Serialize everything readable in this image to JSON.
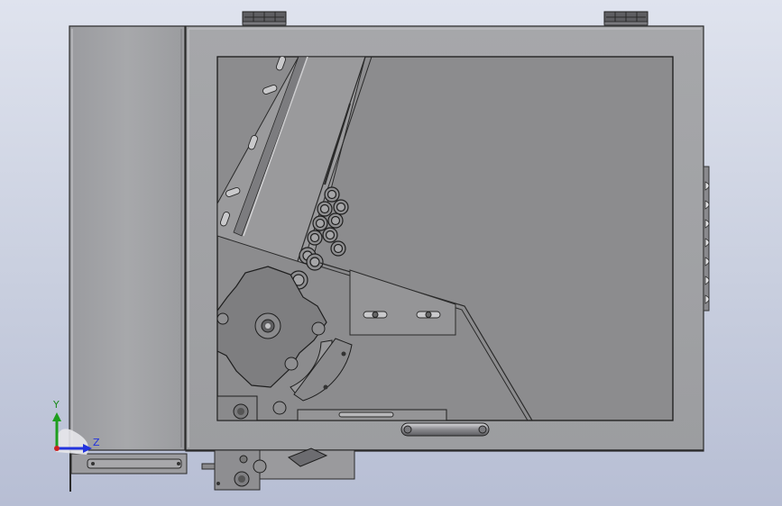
{
  "triad": {
    "y_label": "Y",
    "z_label": "Z",
    "colors": {
      "y": "#1e9e1e",
      "z": "#2233dd",
      "x": "#cc2222"
    }
  },
  "colors": {
    "background_top": "#dfe3ee",
    "background_bottom": "#b7bed4",
    "panel_face": "#a2a3a7",
    "window_interior": "#8c8c8e",
    "outline": "#2a2a2a",
    "hinge": "#5e5e62"
  }
}
